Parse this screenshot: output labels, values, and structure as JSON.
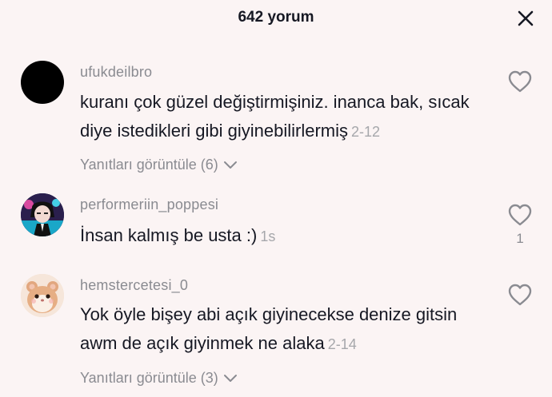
{
  "header": {
    "title": "642 yorum",
    "close_icon": "close-icon"
  },
  "comments": [
    {
      "username": "ufukdeilbro",
      "text": "kuranı çok güzel değiştirmişiniz. inanca bak, sıcak diye istedikleri gibi giyinebilirlermiş",
      "time": "2-12",
      "replies_label": "Yanıtları görüntüle (6)",
      "likes": "",
      "avatar": "black-circle-avatar"
    },
    {
      "username": "performeriin_poppesi",
      "text": "İnsan kalmış be usta :)",
      "time": "1s",
      "replies_label": "",
      "likes": "1",
      "avatar": "anime-character-avatar"
    },
    {
      "username": "hemstercetesi_0",
      "text": "Yok öyle bişey abi açık giyinecekse denize gitsin awm de açık giyinmek ne alaka",
      "time": "2-14",
      "replies_label": "Yanıtları görüntüle (3)",
      "likes": "",
      "avatar": "hamster-avatar"
    }
  ],
  "colors": {
    "background": "#fbf4f4",
    "primary_text": "#161823",
    "secondary_text": "#8a8b91"
  }
}
